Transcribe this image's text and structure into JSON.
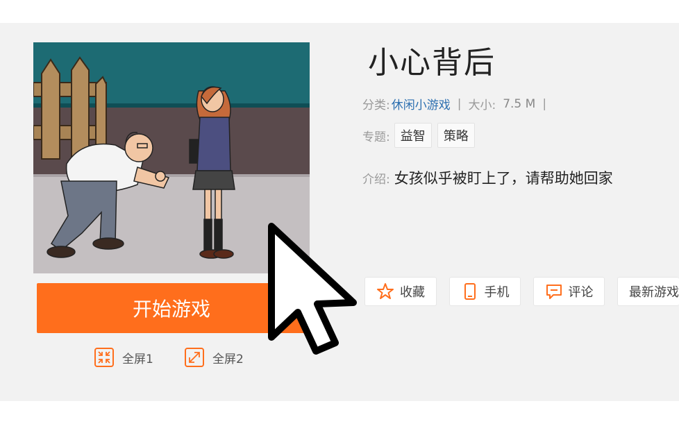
{
  "game": {
    "title": "小心背后",
    "start_label": "开始游戏",
    "fullscreen1_label": "全屏1",
    "fullscreen2_label": "全屏2"
  },
  "meta": {
    "category_label": "分类:",
    "category_value": "休闲小游戏",
    "separator": "|",
    "size_label": "大小:",
    "size_value": "7.5 M",
    "topic_label": "专题:",
    "topics": [
      "益智",
      "策略"
    ],
    "intro_label": "介绍:",
    "intro_text": "女孩似乎被盯上了，请帮助她回家"
  },
  "actions": [
    {
      "label": "收藏",
      "icon": "star-icon"
    },
    {
      "label": "手机",
      "icon": "phone-icon"
    },
    {
      "label": "评论",
      "icon": "comment-icon"
    },
    {
      "label": "最新游戏"
    }
  ],
  "colors": {
    "accent": "#ff6e1c",
    "link": "#2c6fb0",
    "panel_bg": "#f2f2f2"
  }
}
